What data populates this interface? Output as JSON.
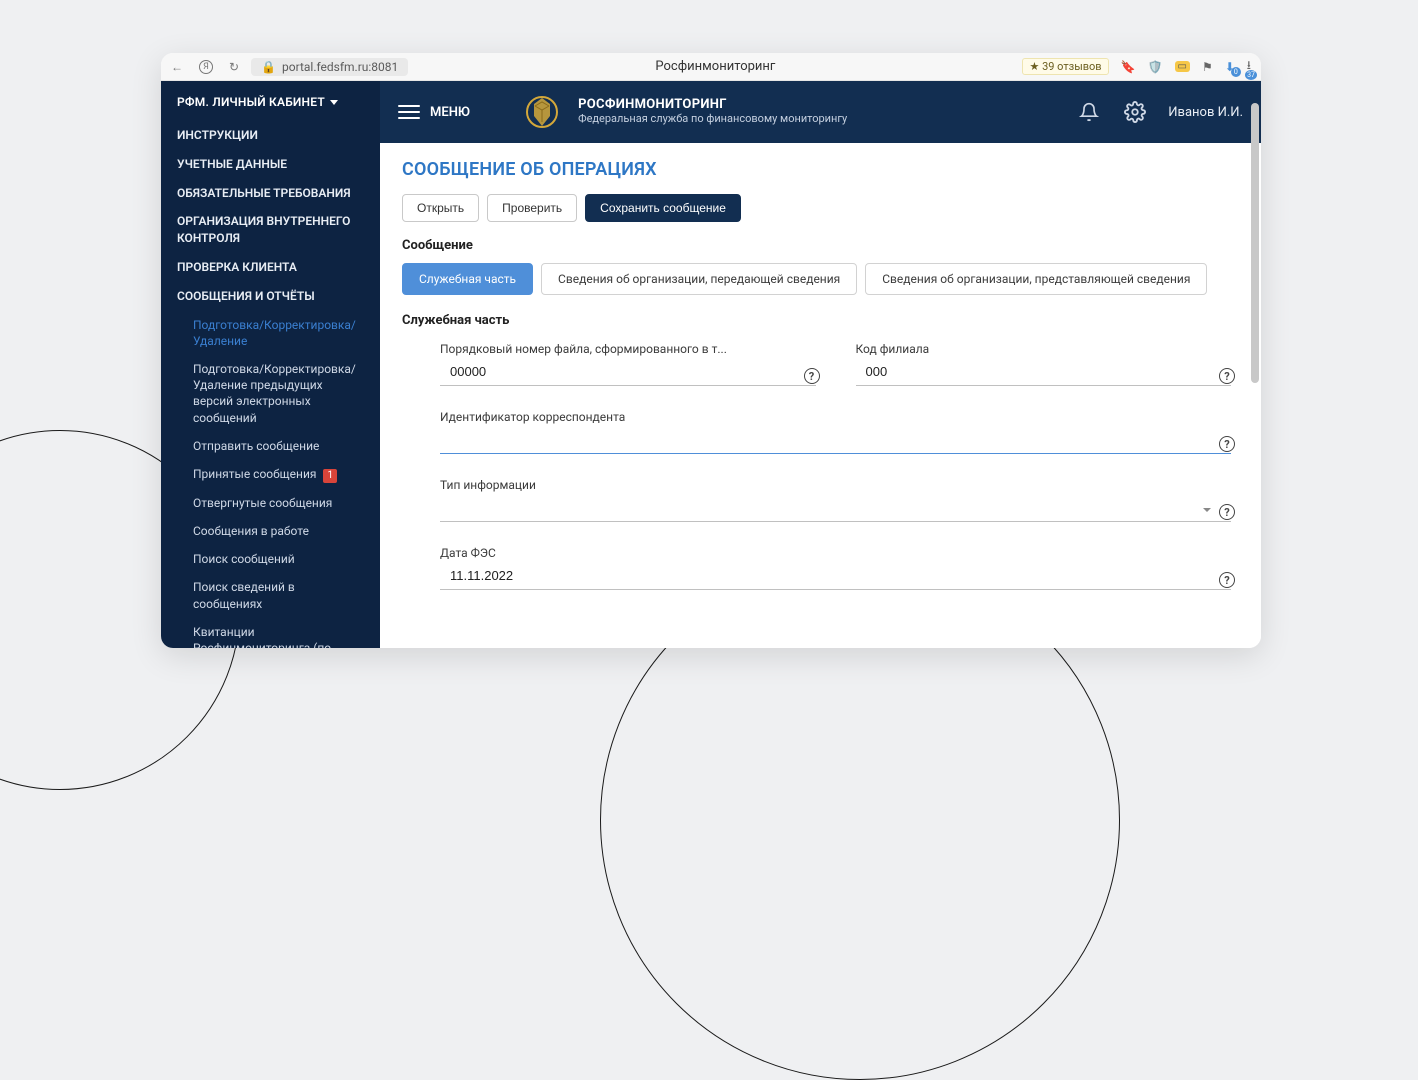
{
  "browser": {
    "address": "portal.fedsfm.ru:8081",
    "title": "Росфинмониторинг",
    "reviews": "39 отзывов"
  },
  "sidebar": {
    "head": "РФМ. ЛИЧНЫЙ КАБИНЕТ",
    "items": [
      "ИНСТРУКЦИИ",
      "УЧЕТНЫЕ ДАННЫЕ",
      "ОБЯЗАТЕЛЬНЫЕ ТРЕБОВАНИЯ",
      "ОРГАНИЗАЦИЯ ВНУТРЕННЕГО КОНТРОЛЯ",
      "ПРОВЕРКА КЛИЕНТА",
      "СООБЩЕНИЯ И ОТЧЁТЫ"
    ],
    "subs": [
      "Подготовка/Корректировка/Удаление",
      "Подготовка/Корректировка/Удаление предыдущих версий электронных сообщений",
      "Отправить сообщение",
      "Принятые сообщения",
      "Отвергнутые сообщения",
      "Сообщения в работе",
      "Поиск сообщений",
      "Поиск сведений в сообщениях",
      "Квитанции Росфинмониторинга (по месяцам)"
    ],
    "badge_accepted": "1"
  },
  "topbar": {
    "menu": "МЕНЮ",
    "brand_title": "РОСФИНМОНИТОРИНГ",
    "brand_sub": "Федеральная служба по финансовому мониторингу",
    "user": "Иванов И.И."
  },
  "page": {
    "title": "СООБЩЕНИЕ ОБ ОПЕРАЦИЯХ",
    "actions": {
      "open": "Открыть",
      "check": "Проверить",
      "save": "Сохранить сообщение"
    },
    "section_label": "Сообщение",
    "tabs": [
      "Служебная часть",
      "Сведения об организации, передающей сведения",
      "Сведения об организации, представляющей сведения"
    ],
    "sub_title": "Служебная часть",
    "fields": {
      "file_seq": {
        "label": "Порядковый номер файла, сформированного в т...",
        "value": "00000"
      },
      "branch_code": {
        "label": "Код филиала",
        "value": "000"
      },
      "correspondent_id": {
        "label": "Идентификатор корреспондента",
        "value": ""
      },
      "info_type": {
        "label": "Тип информации",
        "value": ""
      },
      "fes_date": {
        "label": "Дата ФЭС",
        "value": "11.11.2022"
      }
    }
  }
}
